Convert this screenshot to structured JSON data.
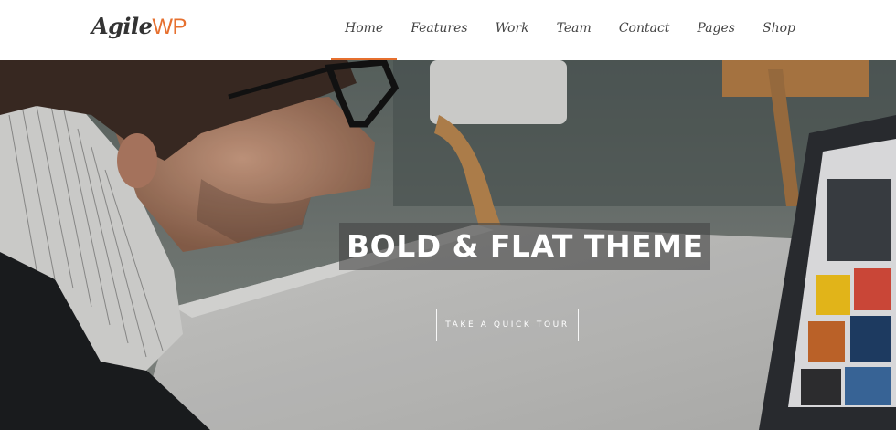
{
  "brand": {
    "name_part1": "Agile",
    "name_part2": "WP",
    "accent": "#e6702f"
  },
  "nav": {
    "items": [
      {
        "label": "Home",
        "active": true
      },
      {
        "label": "Features"
      },
      {
        "label": "Work"
      },
      {
        "label": "Team"
      },
      {
        "label": "Contact"
      },
      {
        "label": "Pages"
      },
      {
        "label": "Shop"
      }
    ]
  },
  "hero": {
    "headline": "BOLD & FLAT THEME",
    "cta_label": "TAKE A QUICK TOUR"
  }
}
